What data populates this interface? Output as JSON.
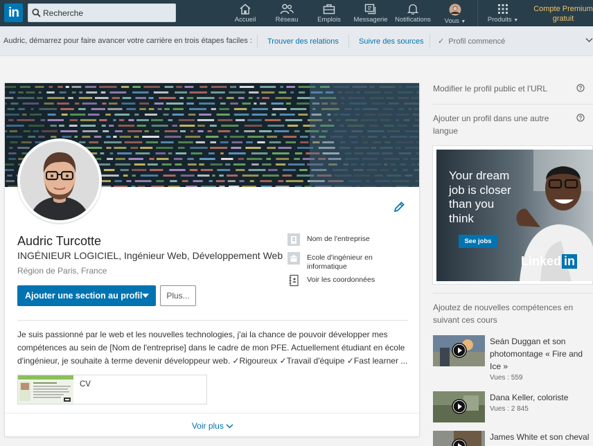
{
  "nav": {
    "logo": "in",
    "search_placeholder": "Recherche",
    "items": [
      {
        "label": "Accueil",
        "icon": "home-icon"
      },
      {
        "label": "Réseau",
        "icon": "network-icon"
      },
      {
        "label": "Emplois",
        "icon": "briefcase-icon"
      },
      {
        "label": "Messagerie",
        "icon": "messaging-icon"
      },
      {
        "label": "Notifications",
        "icon": "bell-icon"
      },
      {
        "label": "Vous",
        "icon": "avatar-icon"
      },
      {
        "label": "Produits",
        "icon": "grid-icon"
      }
    ],
    "premium": "Compte Premium gratuit"
  },
  "onboarding": {
    "text": "Audric, démarrez pour faire avancer votre carrière en trois étapes faciles :",
    "link1": "Trouver des relations",
    "link2": "Suivre des sources",
    "done": "Profil commencé"
  },
  "profile": {
    "name": "Audric Turcotte",
    "headline": "INGÉNIEUR LOGICIEL, Ingénieur Web, Développement Web",
    "location": "Région de Paris, France",
    "add_section_button": "Ajouter une section au profil",
    "more_button": "Plus...",
    "company": "Nom de l'entreprise",
    "school": "Ecole d'ingénieur en informatique",
    "contact": "Voir les coordonnées",
    "summary": "Je suis passionné par le web et les nouvelles technologies, j'ai la chance de pouvoir développer mes compétences au sein de [Nom de l'entreprise] dans le cadre de mon PFE. Actuellement étudiant en école d'ingénieur, je souhaite à terme devenir développeur web. ✓Rigoureux ✓Travail d'équipe ✓Fast learner ...",
    "media_label": "CV",
    "see_more": "Voir plus"
  },
  "rail": {
    "edit_public_profile": "Modifier le profil public et l'URL",
    "add_language_profile": "Ajouter un profil dans une autre langue",
    "ad": {
      "text": "Your dream job is closer than you think",
      "button": "See jobs",
      "logo_prefix": "Linked",
      "logo_in": "in"
    },
    "courses_heading": "Ajoutez de nouvelles compétences en suivant ces cours",
    "courses": [
      {
        "title": "Seán Duggan et son photomontage « Fire and Ice »",
        "views": "Vues : 559"
      },
      {
        "title": "Dana Keller, coloriste",
        "views": "Vues : 2 845"
      },
      {
        "title": "James White et son cheval",
        "views": ""
      }
    ]
  },
  "colors": {
    "nav_bg": "#283e4a",
    "brand_blue": "#0073b1",
    "premium_gold": "#f2c26a"
  }
}
